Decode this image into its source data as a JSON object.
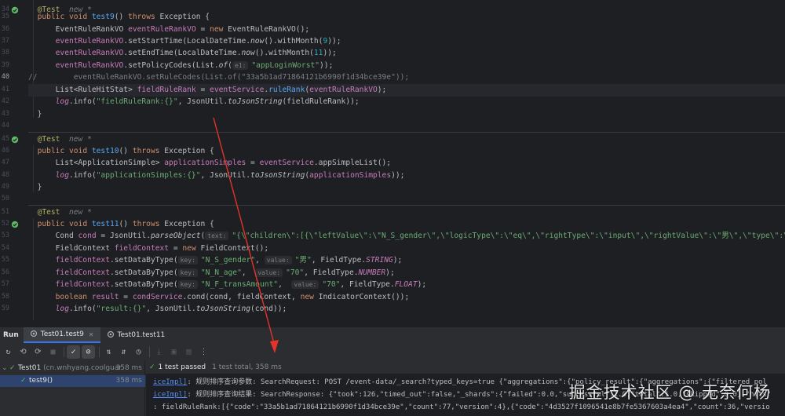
{
  "editor": {
    "lines": [
      {
        "n": "34",
        "run": true
      },
      {
        "n": "35"
      },
      {
        "n": "36"
      },
      {
        "n": "37"
      },
      {
        "n": "38"
      },
      {
        "n": "39"
      },
      {
        "n": "40",
        "current": true
      },
      {
        "n": "41"
      },
      {
        "n": "42"
      },
      {
        "n": "43"
      },
      {
        "n": "44"
      },
      {
        "n": "45",
        "run": true
      },
      {
        "n": "46"
      },
      {
        "n": "47"
      },
      {
        "n": "48"
      },
      {
        "n": "49"
      },
      {
        "n": "50"
      },
      {
        "n": "51"
      },
      {
        "n": "52",
        "run": true
      },
      {
        "n": "53"
      },
      {
        "n": "54"
      },
      {
        "n": "55"
      },
      {
        "n": "56"
      },
      {
        "n": "57"
      },
      {
        "n": "58"
      },
      {
        "n": "59"
      }
    ],
    "code": {
      "l34_ann": "@Test",
      "l34_hint": "new *",
      "l34_kw": "public void ",
      "l34_fn": "test9",
      "l34_rest": "() ",
      "l34_throws": "throws ",
      "l34_exc": "Exception {",
      "l35_a": "EventRuleRankVO ",
      "l35_var": "eventRuleRankVO",
      "l35_b": " = ",
      "l35_kw": "new ",
      "l35_c": "EventRuleRankVO();",
      "l36_var": "eventRuleRankVO",
      "l36_a": ".setStartTime(LocalDateTime.",
      "l36_it": "now",
      "l36_b": "().withMonth(",
      "l36_num": "9",
      "l36_c": "));",
      "l37_var": "eventRuleRankVO",
      "l37_a": ".setEndTime(LocalDateTime.",
      "l37_it": "now",
      "l37_b": "().withMonth(",
      "l37_num": "11",
      "l37_c": "));",
      "l38_var": "eventRuleRankVO",
      "l38_a": ".setPolicyCodes(List.",
      "l38_it": "of",
      "l38_b": "(",
      "l38_hint": "e1:",
      "l38_str": "\"appLoginWorst\"",
      "l38_c": "));",
      "l39_cm": "//        eventRuleRankVO.setRuleCodes(List.of(\"33a5b1ad71864121b6990f1d34bce39e\"));",
      "l40_a": "List<RuleHitStat> ",
      "l40_var": "fieldRuleRank",
      "l40_b": " = ",
      "l40_var2": "eventService",
      "l40_c": ".",
      "l40_fn": "ruleRank",
      "l40_d": "(",
      "l40_var3": "eventRuleRankVO",
      "l40_e": ");",
      "l41_var": "log",
      "l41_a": ".info(",
      "l41_str": "\"fieldRuleRank:{}\"",
      "l41_b": ", JsonUtil.",
      "l41_it": "toJsonString",
      "l41_c": "(fieldRuleRank));",
      "l42": "}",
      "l44_ann": "@Test",
      "l44_hint": "new *",
      "l45_kw": "public void ",
      "l45_fn": "test10",
      "l45_rest": "() ",
      "l45_throws": "throws ",
      "l45_exc": "Exception {",
      "l46_a": "List<ApplicationSimple> ",
      "l46_var": "applicationSimples",
      "l46_b": " = ",
      "l46_var2": "eventService",
      "l46_c": ".appSimpleList();",
      "l47_var": "log",
      "l47_a": ".info(",
      "l47_str": "\"applicationSimples:{}\"",
      "l47_b": ", JsonUtil.",
      "l47_it": "toJsonString",
      "l47_c": "(",
      "l47_var2": "applicationSimples",
      "l47_d": "));",
      "l48": "}",
      "l51_ann": "@Test",
      "l51_hint": "new *",
      "l52_kw": "public void ",
      "l52_fn": "test11",
      "l52_rest": "() ",
      "l52_throws": "throws ",
      "l52_exc": "Exception {",
      "l53_a": "Cond ",
      "l53_var": "cond",
      "l53_b": " = JsonUtil.",
      "l53_it": "parseObject",
      "l53_c": "(",
      "l53_hint": "text:",
      "l53_str": "\"{\\\"children\\\":[{\\\"leftValue\\\":\\\"N_S_gender\\\",\\\"logicType\\\":\\\"eq\\\",\\\"rightType\\\":\\\"input\\\",\\\"rightValue\\\":\\\"男\\\",\\\"type\\\":\\\"norma",
      "l54_a": "FieldContext ",
      "l54_var": "fieldContext",
      "l54_b": " = ",
      "l54_kw": "new ",
      "l54_c": "FieldContext();",
      "l55_var": "fieldContext",
      "l55_a": ".setDataByType(",
      "l55_hint": "key:",
      "l55_str": "\"N_S_gender\"",
      "l55_b": ", ",
      "l55_hint2": "value:",
      "l55_str2": "\"男\"",
      "l55_c": ", FieldType.",
      "l55_const": "STRING",
      "l55_d": ");",
      "l56_var": "fieldContext",
      "l56_a": ".setDataByType(",
      "l56_hint": "key:",
      "l56_str": "\"N_N_age\"",
      "l56_b": ",  ",
      "l56_hint2": "value:",
      "l56_str2": "\"70\"",
      "l56_c": ", FieldType.",
      "l56_const": "NUMBER",
      "l56_d": ");",
      "l57_var": "fieldContext",
      "l57_a": ".setDataByType(",
      "l57_hint": "key:",
      "l57_str": "\"N_F_transAmount\"",
      "l57_b": ",  ",
      "l57_hint2": "value:",
      "l57_str2": "\"70\"",
      "l57_c": ", FieldType.",
      "l57_const": "FLOAT",
      "l57_d": ");",
      "l58_kw": "boolean ",
      "l58_var": "result",
      "l58_a": " = ",
      "l58_var2": "condService",
      "l58_b": ".cond(cond, fieldContext, ",
      "l58_kw2": "new ",
      "l58_c": "IndicatorContext());",
      "l59_var": "log",
      "l59_a": ".info(",
      "l59_str": "\"result:{}\"",
      "l59_b": ", JsonUtil.",
      "l59_it": "toJsonString",
      "l59_c": "(cond));"
    }
  },
  "run": {
    "title": "Run",
    "tabs": [
      {
        "label": "Test01.test9",
        "active": true
      },
      {
        "label": "Test01.test11",
        "active": false
      }
    ],
    "tree": {
      "root_label": "Test01",
      "root_sub": "(cn.wnhyang.coolguar",
      "root_duration": "358 ms",
      "child_label": "test9()",
      "child_duration": "358 ms"
    },
    "status": {
      "passed": "1 test passed",
      "total": "1 test total, 358 ms"
    },
    "console": [
      {
        "link": "iceImpl]",
        "text": ": 规则排序查询参数: SearchRequest: POST /event-data/_search?typed_keys=true {\"aggregations\":{\"policy_result\":{\"aggregations\":{\"filtered_pol"
      },
      {
        "link": "iceImpl]",
        "text": ": 规则排序查询结果: SearchResponse: {\"took\":126,\"timed_out\":false,\"_shards\":{\"failed\":0.0,\"successful\":1.0,\"total\":1.0,\"skipped\":0.0},\"hits\""
      },
      {
        "link": "",
        "text": ": fieldRuleRank:[{\"code\":\"33a5b1ad71864121b6990f1d34bce39e\",\"count\":77,\"version\":4},{\"code\":\"4d3527f1096541e8b7fe5367603a4ea4\",\"count\":36,\"versio"
      }
    ]
  },
  "watermark": "掘金技术社区 @ 无奈何杨",
  "colors": {
    "editor_bg": "#1e1f22",
    "panel_bg": "#2b2d30",
    "keyword": "#cf8e6d",
    "annotation": "#b3ae60",
    "function": "#56a8f5",
    "string": "#6aab73",
    "field": "#c77dbb",
    "number": "#2aacb8",
    "pass_green": "#5fb865",
    "arrow_red": "#e5332a"
  }
}
